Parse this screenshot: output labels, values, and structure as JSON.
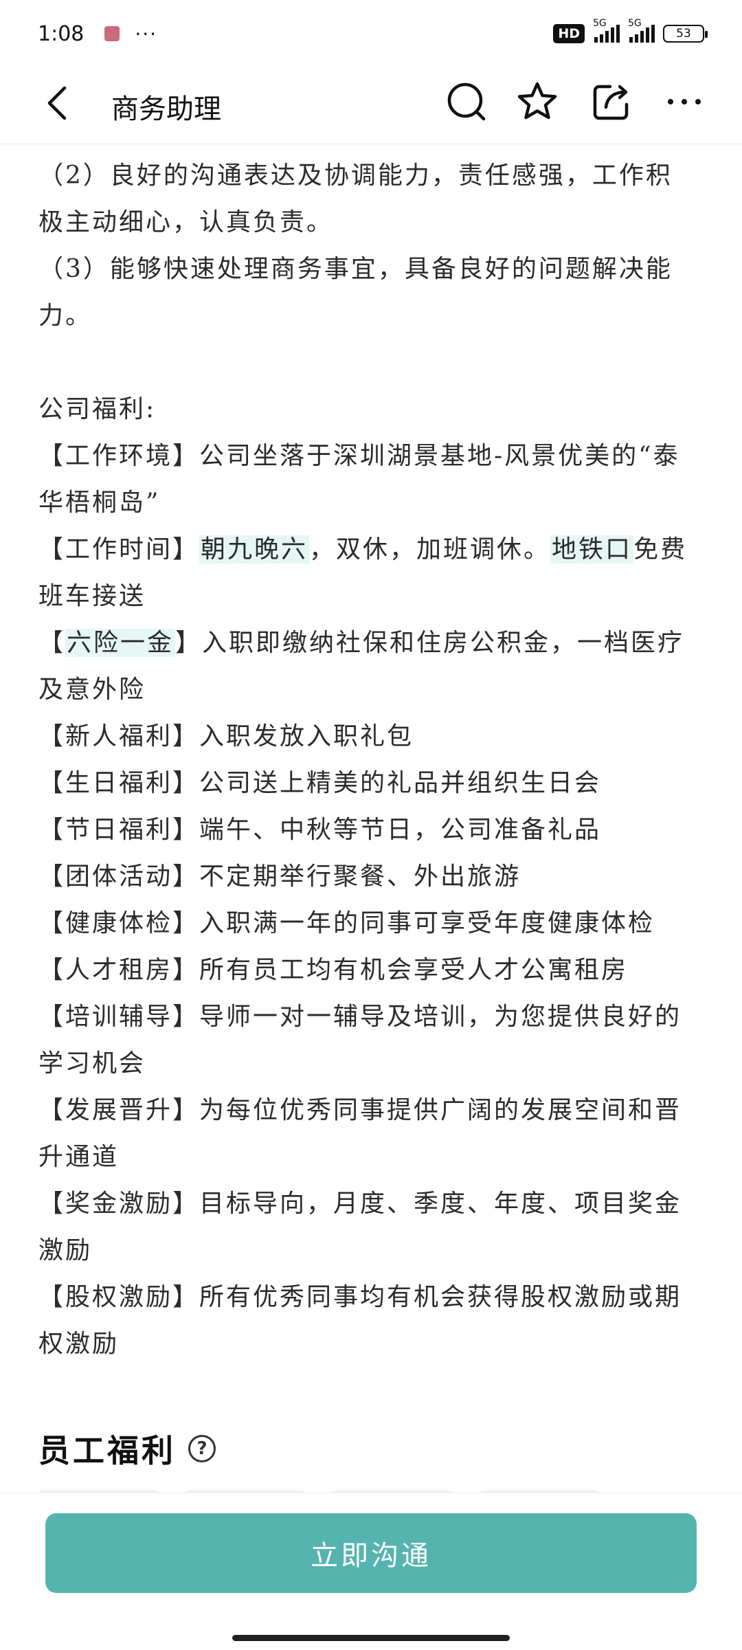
{
  "status_bar": {
    "time": "1:08",
    "dots": "···",
    "hd": "HD",
    "net1": "5G",
    "net2": "5G",
    "battery": "53"
  },
  "nav": {
    "title": "商务助理",
    "icons": [
      "back-icon",
      "search-icon",
      "star-icon",
      "share-icon",
      "more-icon"
    ]
  },
  "content": {
    "req2_l1": "（2）良好的沟通表达及协调能力，责任感强，工作积",
    "req2_l2": "极主动细心，认真负责。",
    "req3_l1": "（3）能够快速处理商务事宜，具备良好的问题解决能",
    "req3_l2": "力。",
    "benefits_heading": "公司福利:",
    "env_l1": "【工作环境】公司坐落于深圳湖景基地-风景优美的“泰",
    "env_l2": "华梧桐岛”",
    "time_prefix": "【工作时间】",
    "time_hl1": "朝九晚六",
    "time_mid": "，双休，加班调休。",
    "time_hl2": "地铁口",
    "time_suffix": "免费",
    "time_l2": "班车接送",
    "ins_prefix": "【",
    "ins_hl": "六险一金",
    "ins_suffix": "】入职即缴纳社保和住房公积金，一档医疗",
    "ins_l2": "及意外险",
    "newhire": "【新人福利】入职发放入职礼包",
    "birthday": "【生日福利】公司送上精美的礼品并组织生日会",
    "festival": "【节日福利】端午、中秋等节日，公司准备礼品",
    "team": "【团体活动】不定期举行聚餐、外出旅游",
    "health": "【健康体检】入职满一年的同事可享受年度健康体检",
    "housing": "【人才租房】所有员工均有机会享受人才公寓租房",
    "training_l1": "【培训辅导】导师一对一辅导及培训，为您提供良好的",
    "training_l2": "学习机会",
    "promotion_l1": "【发展晋升】为每位优秀同事提供广阔的发展空间和晋",
    "promotion_l2": "升通道",
    "bonus_l1": "【奖金激励】目标导向，月度、季度、年度、项目奖金",
    "bonus_l2": "激励",
    "equity_l1": "【股权激励】所有优秀同事均有机会获得股权激励或期",
    "equity_l2": "权激励"
  },
  "section": {
    "title": "员工福利",
    "help": "?"
  },
  "cta": {
    "label": "立即沟通"
  },
  "colors": {
    "accent": "#55b4b0",
    "highlight": "#e6f6f4"
  }
}
